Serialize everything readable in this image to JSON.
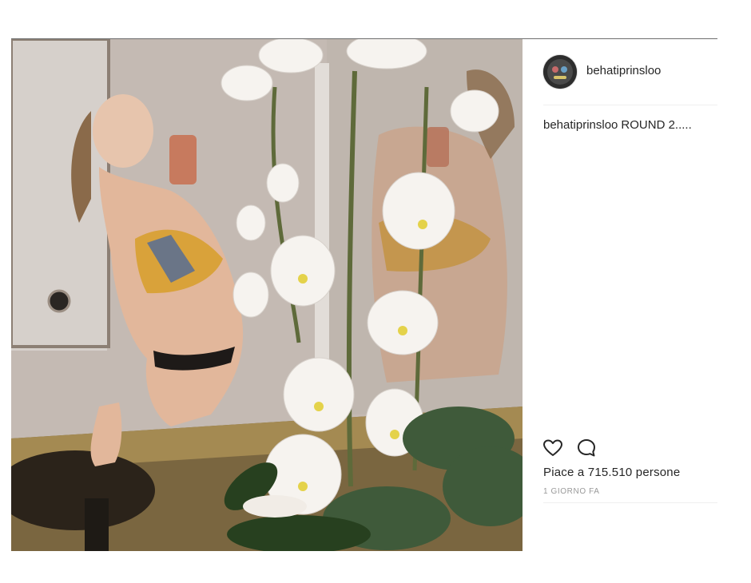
{
  "post": {
    "username": "behatiprinsloo",
    "caption": {
      "username": "behatiprinsloo",
      "text": "ROUND 2....."
    },
    "likes_text": "Piace a 715.510 persone",
    "time_text": "1 GIORNO FA",
    "icons": {
      "like": "heart-outline-icon",
      "comment": "comment-bubble-icon"
    },
    "colors": {
      "text": "#262626",
      "muted": "#999999",
      "divider": "#efefef"
    }
  }
}
